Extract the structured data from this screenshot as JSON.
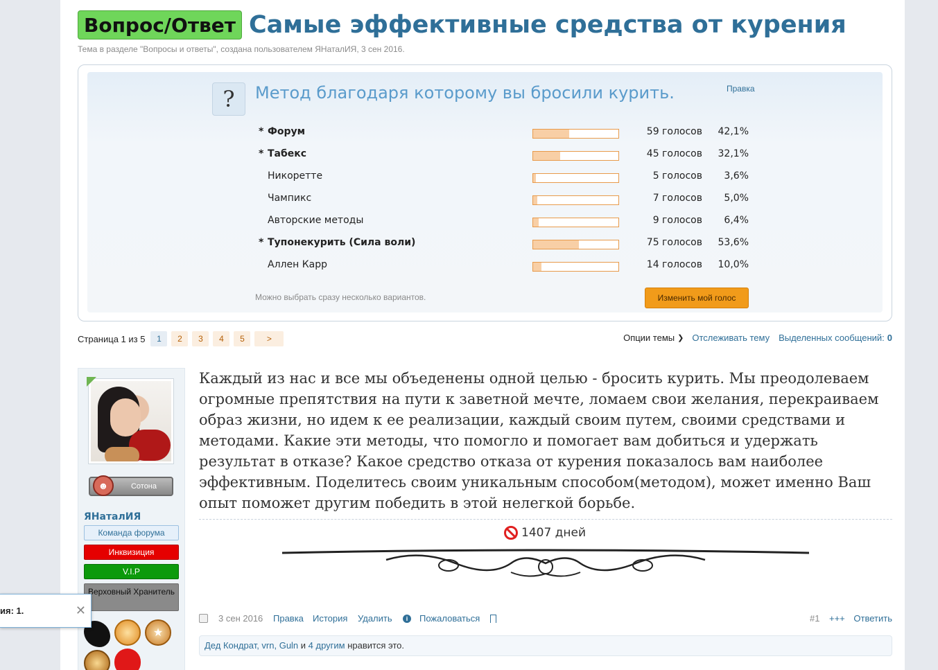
{
  "thread": {
    "prefix": "Вопрос/Ответ",
    "title": "Самые эффективные средства от курения",
    "subtitle": "Тема в разделе \"Вопросы и ответы\", создана пользователем ЯНаталИЯ, 3 сен 2016."
  },
  "poll": {
    "question": "Метод благодаря которому вы бросили курить.",
    "edit_label": "Правка",
    "options": [
      {
        "marker": "*",
        "label": "Форум",
        "votes": "59 голосов",
        "percent": "42,1%",
        "fraction": 0.421
      },
      {
        "marker": "*",
        "label": "Табекс",
        "votes": "45 голосов",
        "percent": "32,1%",
        "fraction": 0.321
      },
      {
        "marker": "",
        "label": "Никоретте",
        "votes": "5 голосов",
        "percent": "3,6%",
        "fraction": 0.036
      },
      {
        "marker": "",
        "label": "Чампикс",
        "votes": "7 голосов",
        "percent": "5,0%",
        "fraction": 0.05
      },
      {
        "marker": "",
        "label": "Авторские методы",
        "votes": "9 голосов",
        "percent": "6,4%",
        "fraction": 0.064
      },
      {
        "marker": "*",
        "label": "Тупонекурить (Сила воли)",
        "votes": "75 голосов",
        "percent": "53,6%",
        "fraction": 0.536
      },
      {
        "marker": "",
        "label": "Аллен Карр",
        "votes": "14 голосов",
        "percent": "10,0%",
        "fraction": 0.1
      }
    ],
    "note": "Можно выбрать сразу несколько вариантов.",
    "change_vote_button": "Изменить мой голос"
  },
  "pager": {
    "label": "Страница 1 из 5",
    "pages": [
      "1",
      "2",
      "3",
      "4",
      "5"
    ],
    "next": ">"
  },
  "thread_tools": {
    "options_label": "Опции темы",
    "watch_label": "Отслеживать тему",
    "selected_label": "Выделенных сообщений:",
    "selected_count": "0"
  },
  "user": {
    "rank": "Сотона",
    "name": "ЯНаталИЯ",
    "banners": {
      "team": "Команда форума",
      "inquisition": "Инквизиция",
      "vip": "V.I.P",
      "keeper": "Верховный Хранитель"
    }
  },
  "post": {
    "text": "Каждый из нас и все мы объеденены одной целью - бросить курить. Мы преодолеваем огромные препятствия на пути к заветной мечте, ломаем свои желания, перекраиваем образ жизни, но идем к ее реализации, каждый своим путем, своими средствами и методами. Какие эти методы, что помогло и помогает вам добиться и удержать результат в отказе? Какое средство отказа от курения показалось вам наиболее эффективным. Поделитесь своим уникальным способом(методом), может именно Ваш опыт поможет другим победить в этой нелегкой борьбе.",
    "signature_days": "1407 дней",
    "date": "3 сен 2016",
    "actions": {
      "edit": "Правка",
      "history": "История",
      "delete": "Удалить",
      "report": "Пожаловаться",
      "number": "#1",
      "plus": "+++",
      "reply": "Ответить"
    },
    "likes": {
      "users": "Дед Кондрат, vrn, Guln",
      "and": " и ",
      "others": "4 другим",
      "suffix": " нравится это."
    }
  },
  "toast": {
    "text": "ия: 1."
  },
  "colors": {
    "accent": "#2f6f98",
    "prefix_bg": "#6fd65a",
    "vote_button": "#f19b1a",
    "bar_fill": "#f8cfa6",
    "bar_border": "#e89a4a"
  }
}
